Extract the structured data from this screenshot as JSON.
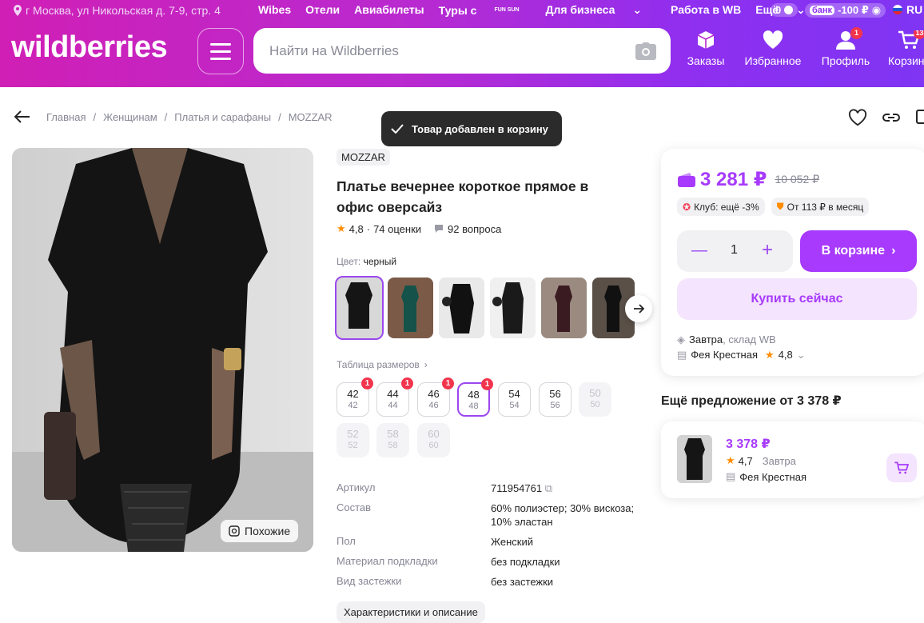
{
  "header": {
    "location": "г Москва, ул Никольская д. 7-9, стр. 4",
    "nav": [
      "Wibes",
      "Отели",
      "Авиабилеты",
      "Туры с",
      "Для бизнеса",
      "Работа в WB",
      "Ещё"
    ],
    "tours_badge": "FUN SUN",
    "balance": "0",
    "bank_label": "банк",
    "bank_amount": "-100 ₽",
    "lang": "RU",
    "logo": "wildberries",
    "search_placeholder": "Найти на Wildberries",
    "icons": [
      {
        "label": "Заказы",
        "icon": "box-icon"
      },
      {
        "label": "Избранное",
        "icon": "heart-icon"
      },
      {
        "label": "Профиль",
        "icon": "user-icon",
        "badge": "1"
      },
      {
        "label": "Корзина",
        "icon": "cart-icon",
        "badge": "13"
      }
    ]
  },
  "breadcrumbs": [
    "Главная",
    "Женщинам",
    "Платья и сарафаны",
    "MOZZAR"
  ],
  "toast": "Товар добавлен в корзину",
  "product": {
    "similar_label": "Похожие",
    "brand": "MOZZAR",
    "title": "Платье вечернее короткое прямое в офис оверсайз",
    "rating": "4,8",
    "reviews": "74 оценки",
    "questions": "92 вопроса",
    "color_label": "Цвет:",
    "color_value": "черный",
    "size_table": "Таблица размеров",
    "sizes": [
      {
        "a": "42",
        "b": "42",
        "badge": "1",
        "state": "normal"
      },
      {
        "a": "44",
        "b": "44",
        "badge": "1",
        "state": "normal"
      },
      {
        "a": "46",
        "b": "46",
        "badge": "1",
        "state": "normal"
      },
      {
        "a": "48",
        "b": "48",
        "badge": "1",
        "state": "selected"
      },
      {
        "a": "54",
        "b": "54",
        "badge": "",
        "state": "normal"
      },
      {
        "a": "56",
        "b": "56",
        "badge": "",
        "state": "normal"
      },
      {
        "a": "50",
        "b": "50",
        "badge": "",
        "state": "disabled"
      },
      {
        "a": "52",
        "b": "52",
        "badge": "",
        "state": "disabled"
      },
      {
        "a": "58",
        "b": "58",
        "badge": "",
        "state": "disabled"
      },
      {
        "a": "60",
        "b": "60",
        "badge": "",
        "state": "disabled"
      }
    ],
    "specs": [
      {
        "k": "Артикул",
        "v": "711954761"
      },
      {
        "k": "Состав",
        "v": "60% полиэстер; 30% вискоза; 10% эластан"
      },
      {
        "k": "Пол",
        "v": "Женский"
      },
      {
        "k": "Материал подкладки",
        "v": "без подкладки"
      },
      {
        "k": "Вид застежки",
        "v": "без застежки"
      }
    ],
    "desc_button": "Характеристики и описание"
  },
  "buybox": {
    "price": "3 281 ₽",
    "old_price": "10 052 ₽",
    "club": "Клуб: ещё -3%",
    "installment": "От 113 ₽ в месяц",
    "qty": "1",
    "in_cart": "В корзине",
    "buy_now": "Купить сейчас",
    "delivery_day": "Завтра",
    "delivery_from": ", склад WB",
    "seller": "Фея Крестная",
    "seller_rating": "4,8"
  },
  "other_offer": {
    "title": "Ещё предложение от 3 378 ₽",
    "price": "3 378 ₽",
    "rating": "4,7",
    "delivery": "Завтра",
    "seller": "Фея Крестная"
  }
}
